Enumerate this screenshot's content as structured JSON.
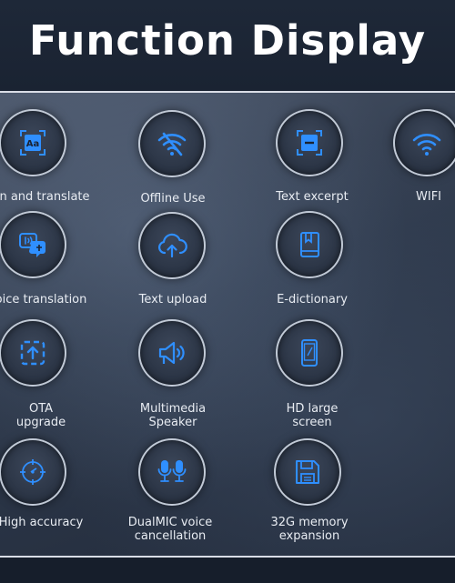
{
  "header": {
    "title": "Function Display"
  },
  "features": [
    {
      "id": "scan",
      "icon": "scan-translate-icon",
      "label": "an and translate"
    },
    {
      "id": "offline",
      "icon": "offline-wifi-icon",
      "label": "Offline Use"
    },
    {
      "id": "excerpt",
      "icon": "text-excerpt-icon",
      "label": "Text excerpt"
    },
    {
      "id": "wifi",
      "icon": "wifi-icon",
      "label": "WIFI"
    },
    {
      "id": "voice",
      "icon": "voice-translation-icon",
      "label": "oice translation"
    },
    {
      "id": "upload",
      "icon": "cloud-upload-icon",
      "label": "Text upload"
    },
    {
      "id": "dictionary",
      "icon": "book-icon",
      "label": "E-dictionary"
    },
    {
      "id": "ota",
      "icon": "ota-upgrade-icon",
      "label_line1": "OTA",
      "label_line2": "upgrade"
    },
    {
      "id": "speaker",
      "icon": "speaker-icon",
      "label_line1": "Multimedia",
      "label_line2": "Speaker"
    },
    {
      "id": "screen",
      "icon": "phone-screen-icon",
      "label_line1": "HD large",
      "label_line2": "screen"
    },
    {
      "id": "accuracy",
      "icon": "target-icon",
      "label": "High accuracy"
    },
    {
      "id": "dualmic",
      "icon": "dual-microphone-icon",
      "label_line1": "DualMIC voice",
      "label_line2": "cancellation"
    },
    {
      "id": "memory",
      "icon": "floppy-disk-icon",
      "label_line1": "32G memory",
      "label_line2": "expansion"
    }
  ],
  "colors": {
    "accent": "#2f8fff",
    "background": "#1b2332",
    "text": "#e8ecf2"
  }
}
